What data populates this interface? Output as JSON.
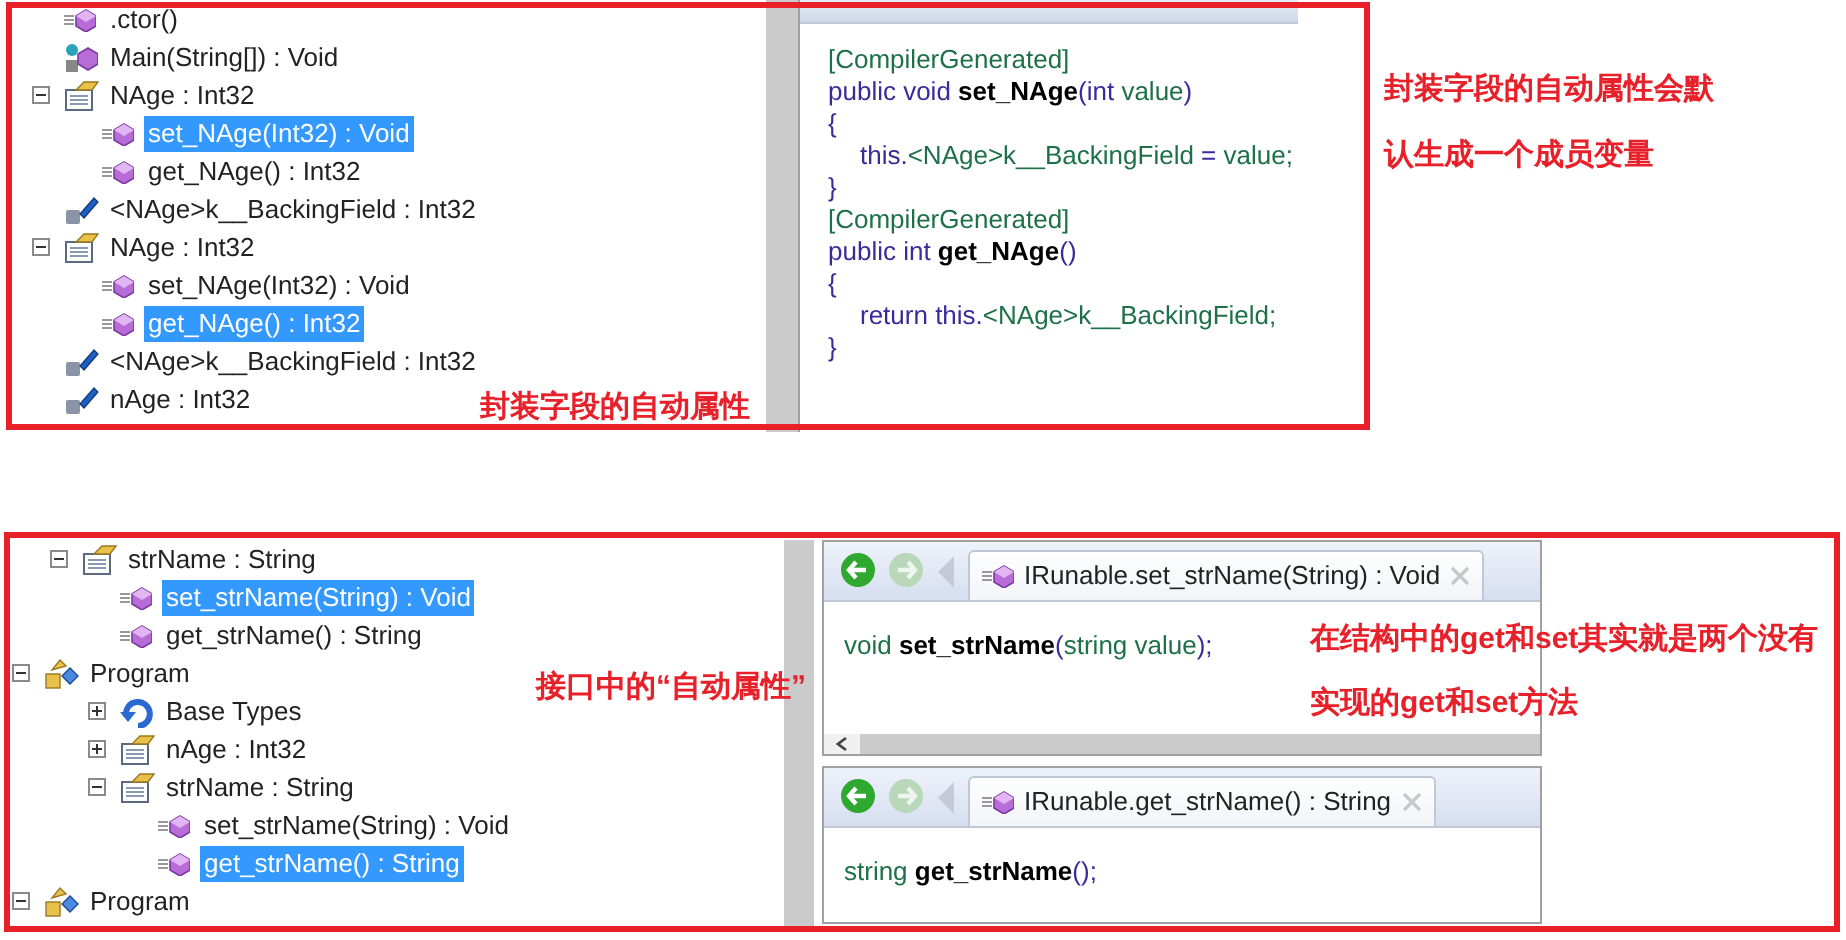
{
  "top": {
    "tree": [
      {
        "kind": "method",
        "label": ".ctor()",
        "selected": false
      },
      {
        "kind": "static-method",
        "label": "Main(String[]) : Void",
        "selected": false
      },
      {
        "kind": "property",
        "label": "NAge : Int32",
        "selected": false,
        "expanded": true,
        "children": [
          {
            "kind": "method",
            "label": "set_NAge(Int32) : Void",
            "selected": true
          },
          {
            "kind": "method",
            "label": "get_NAge() : Int32",
            "selected": false
          }
        ]
      },
      {
        "kind": "field",
        "label": "<NAge>k__BackingField : Int32",
        "selected": false
      },
      {
        "kind": "property",
        "label": "NAge : Int32",
        "selected": false,
        "expanded": true,
        "children": [
          {
            "kind": "method",
            "label": "set_NAge(Int32) : Void",
            "selected": false
          },
          {
            "kind": "method",
            "label": "get_NAge() : Int32",
            "selected": true
          }
        ]
      },
      {
        "kind": "field",
        "label": "<NAge>k__BackingField : Int32",
        "selected": false
      },
      {
        "kind": "field",
        "label": "nAge : Int32",
        "selected": false
      }
    ],
    "code": [
      [
        {
          "kind": "id",
          "text": "[CompilerGenerated]"
        }
      ],
      [
        {
          "kind": "kw",
          "text": "public void "
        },
        {
          "kind": "name",
          "text": "set_NAge"
        },
        {
          "kind": "punct",
          "text": "("
        },
        {
          "kind": "kw",
          "text": "int "
        },
        {
          "kind": "id",
          "text": "value"
        },
        {
          "kind": "punct",
          "text": ")"
        }
      ],
      [
        {
          "kind": "punct",
          "text": "{"
        }
      ],
      [
        {
          "kind": "indent"
        },
        {
          "kind": "kw",
          "text": "this."
        },
        {
          "kind": "id",
          "text": "<NAge>k__BackingField"
        },
        {
          "kind": "punct",
          "text": " = "
        },
        {
          "kind": "id",
          "text": "value;"
        }
      ],
      [
        {
          "kind": "punct",
          "text": "}"
        }
      ],
      [
        {
          "kind": "id",
          "text": "[CompilerGenerated]"
        }
      ],
      [
        {
          "kind": "kw",
          "text": "public int "
        },
        {
          "kind": "name",
          "text": "get_NAge"
        },
        {
          "kind": "punct",
          "text": "()"
        }
      ],
      [
        {
          "kind": "punct",
          "text": "{"
        }
      ],
      [
        {
          "kind": "indent"
        },
        {
          "kind": "kw",
          "text": "return this."
        },
        {
          "kind": "id",
          "text": "<NAge>k__BackingField;"
        }
      ],
      [
        {
          "kind": "punct",
          "text": "}"
        }
      ]
    ],
    "annotations": [
      "封装字段的自动属性",
      "封装字段的自动属性会默认生成一个成员变量"
    ]
  },
  "bottom": {
    "tree": [
      {
        "kind": "property",
        "label": "strName : String",
        "selected": false,
        "expanded": true,
        "children": [
          {
            "kind": "method",
            "label": "set_strName(String) : Void",
            "selected": true
          },
          {
            "kind": "method",
            "label": "get_strName() : String",
            "selected": false
          }
        ]
      },
      {
        "kind": "class",
        "label": "Program",
        "selected": false,
        "expanded": true,
        "children": [
          {
            "kind": "base-types",
            "label": "Base Types",
            "selected": false,
            "expanded": false
          },
          {
            "kind": "property",
            "label": "nAge : Int32",
            "selected": false,
            "expanded": false
          },
          {
            "kind": "property",
            "label": "strName : String",
            "selected": false,
            "expanded": true,
            "children": [
              {
                "kind": "method",
                "label": "set_strName(String) : Void",
                "selected": false
              },
              {
                "kind": "method",
                "label": "get_strName() : String",
                "selected": true
              }
            ]
          }
        ]
      },
      {
        "kind": "class",
        "label": "Program",
        "selected": false,
        "expanded": true
      }
    ],
    "panes": [
      {
        "tab": "IRunable.set_strName(String) : Void",
        "code": [
          {
            "kind": "id",
            "text": "void "
          },
          {
            "kind": "name",
            "text": "set_strName"
          },
          {
            "kind": "punct",
            "text": "("
          },
          {
            "kind": "id",
            "text": "string value"
          },
          {
            "kind": "punct",
            "text": ");"
          }
        ]
      },
      {
        "tab": "IRunable.get_strName() : String",
        "code": [
          {
            "kind": "id",
            "text": "string "
          },
          {
            "kind": "name",
            "text": "get_strName"
          },
          {
            "kind": "punct",
            "text": "();"
          }
        ]
      }
    ],
    "annotations": [
      "接口中的“自动属性”",
      "在结构中的get和set其实就是两个没有实现的get和set方法"
    ]
  }
}
